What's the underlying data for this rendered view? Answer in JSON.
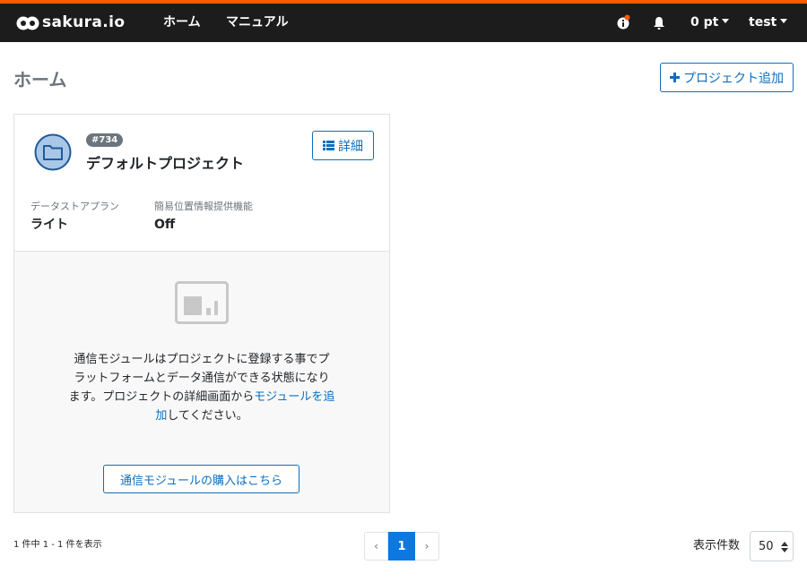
{
  "header": {
    "logo_text": "sakura.io",
    "nav": [
      {
        "label": "ホーム"
      },
      {
        "label": "マニュアル"
      }
    ],
    "points_label": "0 pt",
    "user_label": "test",
    "accent": "#ff5a00"
  },
  "page": {
    "title": "ホーム",
    "add_project_label": "プロジェクト追加"
  },
  "project": {
    "id_badge": "#734",
    "name": "デフォルトプロジェクト",
    "detail_label": "詳細",
    "plan_label": "データストアプラン",
    "plan_value": "ライト",
    "location_label": "簡易位置情報提供機能",
    "location_value": "Off"
  },
  "empty_state": {
    "text_before": "通信モジュールはプロジェクトに登録する事でプラットフォームとデータ通信ができる状態になります。プロジェクトの詳細画面から",
    "link_text": "モジュールを追加",
    "text_after": "してください。",
    "buy_label": "通信モジュールの購入はこちら"
  },
  "footer": {
    "count_text": "1 件中 1 - 1 件を表示",
    "pager": {
      "prev": "‹",
      "current": "1",
      "next": "›"
    },
    "per_page_label": "表示件数",
    "per_page_value": "50"
  }
}
